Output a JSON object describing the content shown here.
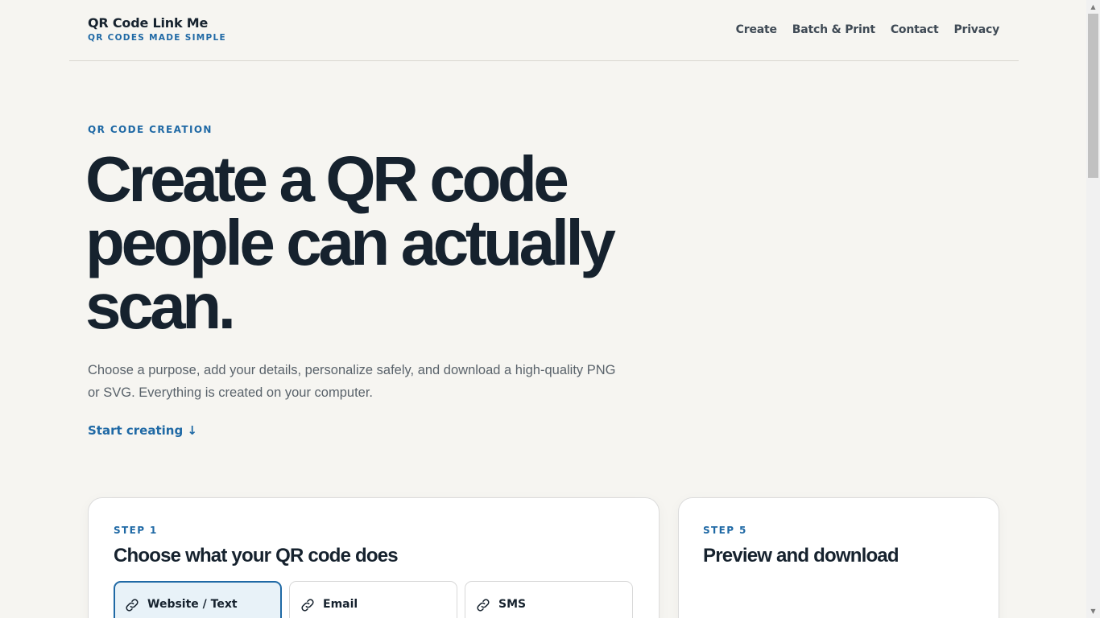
{
  "header": {
    "brand_name": "QR Code Link Me",
    "brand_tagline": "QR CODES MADE SIMPLE",
    "nav": [
      {
        "label": "Create"
      },
      {
        "label": "Batch & Print"
      },
      {
        "label": "Contact"
      },
      {
        "label": "Privacy"
      }
    ]
  },
  "hero": {
    "eyebrow": "QR CODE CREATION",
    "title_line1": "Create a QR code",
    "title_line2": "people can actually",
    "title_line3": "scan.",
    "description": "Choose a purpose, add your details, personalize safely, and download a high-quality PNG or SVG. Everything is created on your computer.",
    "cta": "Start creating ↓"
  },
  "step1": {
    "label": "STEP 1",
    "title": "Choose what your QR code does",
    "options": [
      {
        "label": "Website / Text",
        "icon": "link-icon",
        "selected": true
      },
      {
        "label": "Email",
        "icon": "link-icon",
        "selected": false
      },
      {
        "label": "SMS",
        "icon": "link-icon",
        "selected": false
      }
    ]
  },
  "step5": {
    "label": "STEP 5",
    "title": "Preview and download"
  },
  "colors": {
    "accent": "#1f69a5",
    "background": "#f6f5f1",
    "text": "#16222e",
    "selected_bg": "#e8f2f8"
  }
}
